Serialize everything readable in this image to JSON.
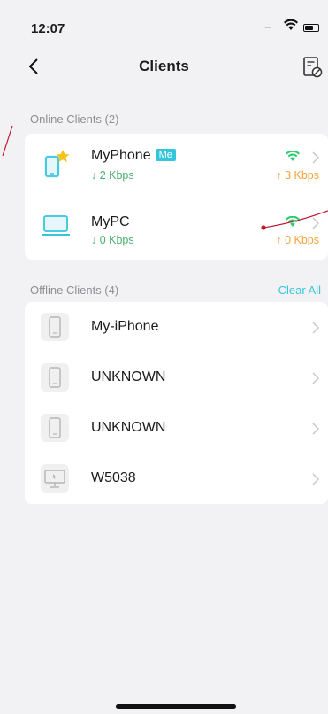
{
  "status_bar": {
    "time": "12:07",
    "signal_dots": "....."
  },
  "nav": {
    "title": "Clients",
    "back_icon": "chevron-left-icon",
    "action_icon": "document-block-icon"
  },
  "online": {
    "header": "Online Clients (2)",
    "clients": [
      {
        "name": "MyPhone",
        "badge": "Me",
        "down": "↓ 2 Kbps",
        "up": "↑ 3 Kbps",
        "icon": "phone-star-icon"
      },
      {
        "name": "MyPC",
        "down": "↓ 0 Kbps",
        "up": "↑ 0 Kbps",
        "icon": "laptop-icon"
      }
    ]
  },
  "offline": {
    "header": "Offline Clients (4)",
    "clear_label": "Clear All",
    "clients": [
      {
        "name": "My-iPhone",
        "icon": "phone-icon"
      },
      {
        "name": "UNKNOWN",
        "icon": "phone-icon"
      },
      {
        "name": "UNKNOWN",
        "icon": "phone-icon"
      },
      {
        "name": "W5038",
        "icon": "desktop-icon"
      }
    ]
  },
  "colors": {
    "accent": "#35c6dc",
    "down": "#4caf6e",
    "up": "#f6a33b",
    "wifi": "#2ecc71",
    "annotation": "#c0182a"
  }
}
